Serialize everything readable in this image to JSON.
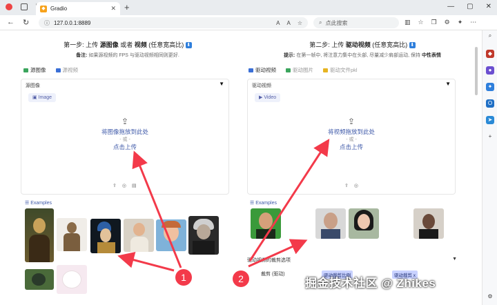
{
  "browser": {
    "tab_title": "Gradio",
    "tab_close": "✕",
    "new_tab": "+",
    "url": "127.0.0.1:8889",
    "search_placeholder": "点此搜索",
    "window_controls": [
      "—",
      "▢",
      "✕"
    ]
  },
  "left_panel": {
    "title_prefix": "第一步: 上传",
    "title_strong1": "源图像",
    "title_mid": "或者",
    "title_strong2": "视频",
    "title_suffix": "(任意宽高比)",
    "note_label": "备注:",
    "note_text": "如果源视频的 FPS 与驱动视频相同则更好.",
    "tabs": [
      "源图像",
      "源视频"
    ],
    "box_label": "源图像",
    "chip_label": "Image",
    "upload_line1": "将图像拖放到此处",
    "upload_or": "- 或 -",
    "upload_line2": "点击上传",
    "examples_label": "Examples"
  },
  "right_panel": {
    "title_prefix": "第二步: 上传",
    "title_strong": "驱动视频",
    "title_suffix": "(任意宽高比)",
    "tip_label": "提示:",
    "tip_text": "在第一帧中, 将注意力集中在头部, 尽量减少肩部运动, 保持",
    "tip_strong": "中性表情",
    "tabs": [
      "驱动视频",
      "驱动图片",
      "驱动文件pkl"
    ],
    "box_label": "驱动视频",
    "chip_label": "Video",
    "upload_line1": "将视频拖放到此处",
    "upload_or": "- 或 -",
    "upload_line2": "点击上传",
    "examples_label": "Examples",
    "options_label": "驱动视频的裁剪选项",
    "crop_label": "裁剪 (驱动)",
    "tag1": "驱动裁剪比例",
    "tag2": "驱动裁剪 x"
  },
  "annotations": {
    "callout_1": "1",
    "callout_2": "2",
    "color": "#f33a4a"
  },
  "watermark": "掘金技术社区 @ Zhikes",
  "colors": {
    "accent": "#3f5aa9",
    "download_badge": "#2f7fdc"
  }
}
